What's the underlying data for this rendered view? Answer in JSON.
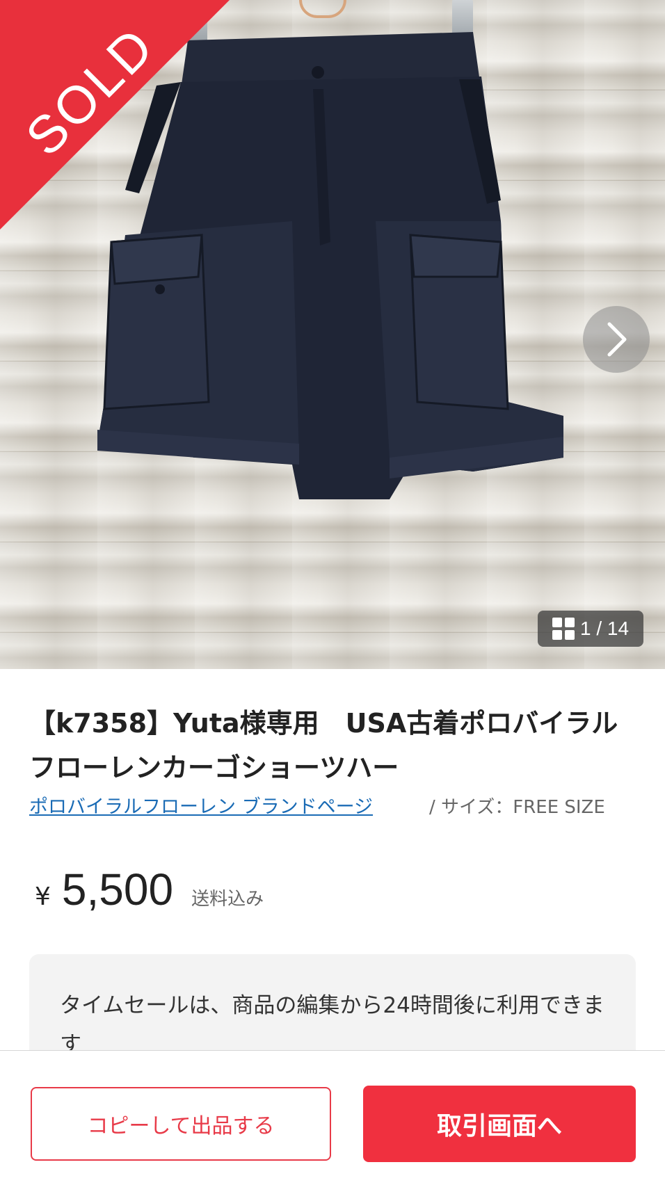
{
  "image": {
    "sold_label": "SOLD",
    "counter": "1 / 14",
    "icons": {
      "next": "chevron-right-icon",
      "gallery": "grid-icon"
    }
  },
  "product": {
    "title": "【k7358】Yuta様専用　USA古着ポロバイラルフローレンカーゴショーツハー",
    "brand_link": "ポロバイラルフローレン ブランドページ",
    "size": "/ サイズ：FREE SIZE",
    "currency": "¥",
    "price": "5,500",
    "shipping": "送料込み"
  },
  "notice": {
    "text": "タイムセールは、商品の編集から24時間後に利用できます"
  },
  "actions": {
    "copy_label": "コピーして出品する",
    "trade_label": "取引画面へ"
  },
  "colors": {
    "accent": "#f0303f",
    "sold_ribbon": "#e8303c",
    "link": "#1a6bb5"
  }
}
